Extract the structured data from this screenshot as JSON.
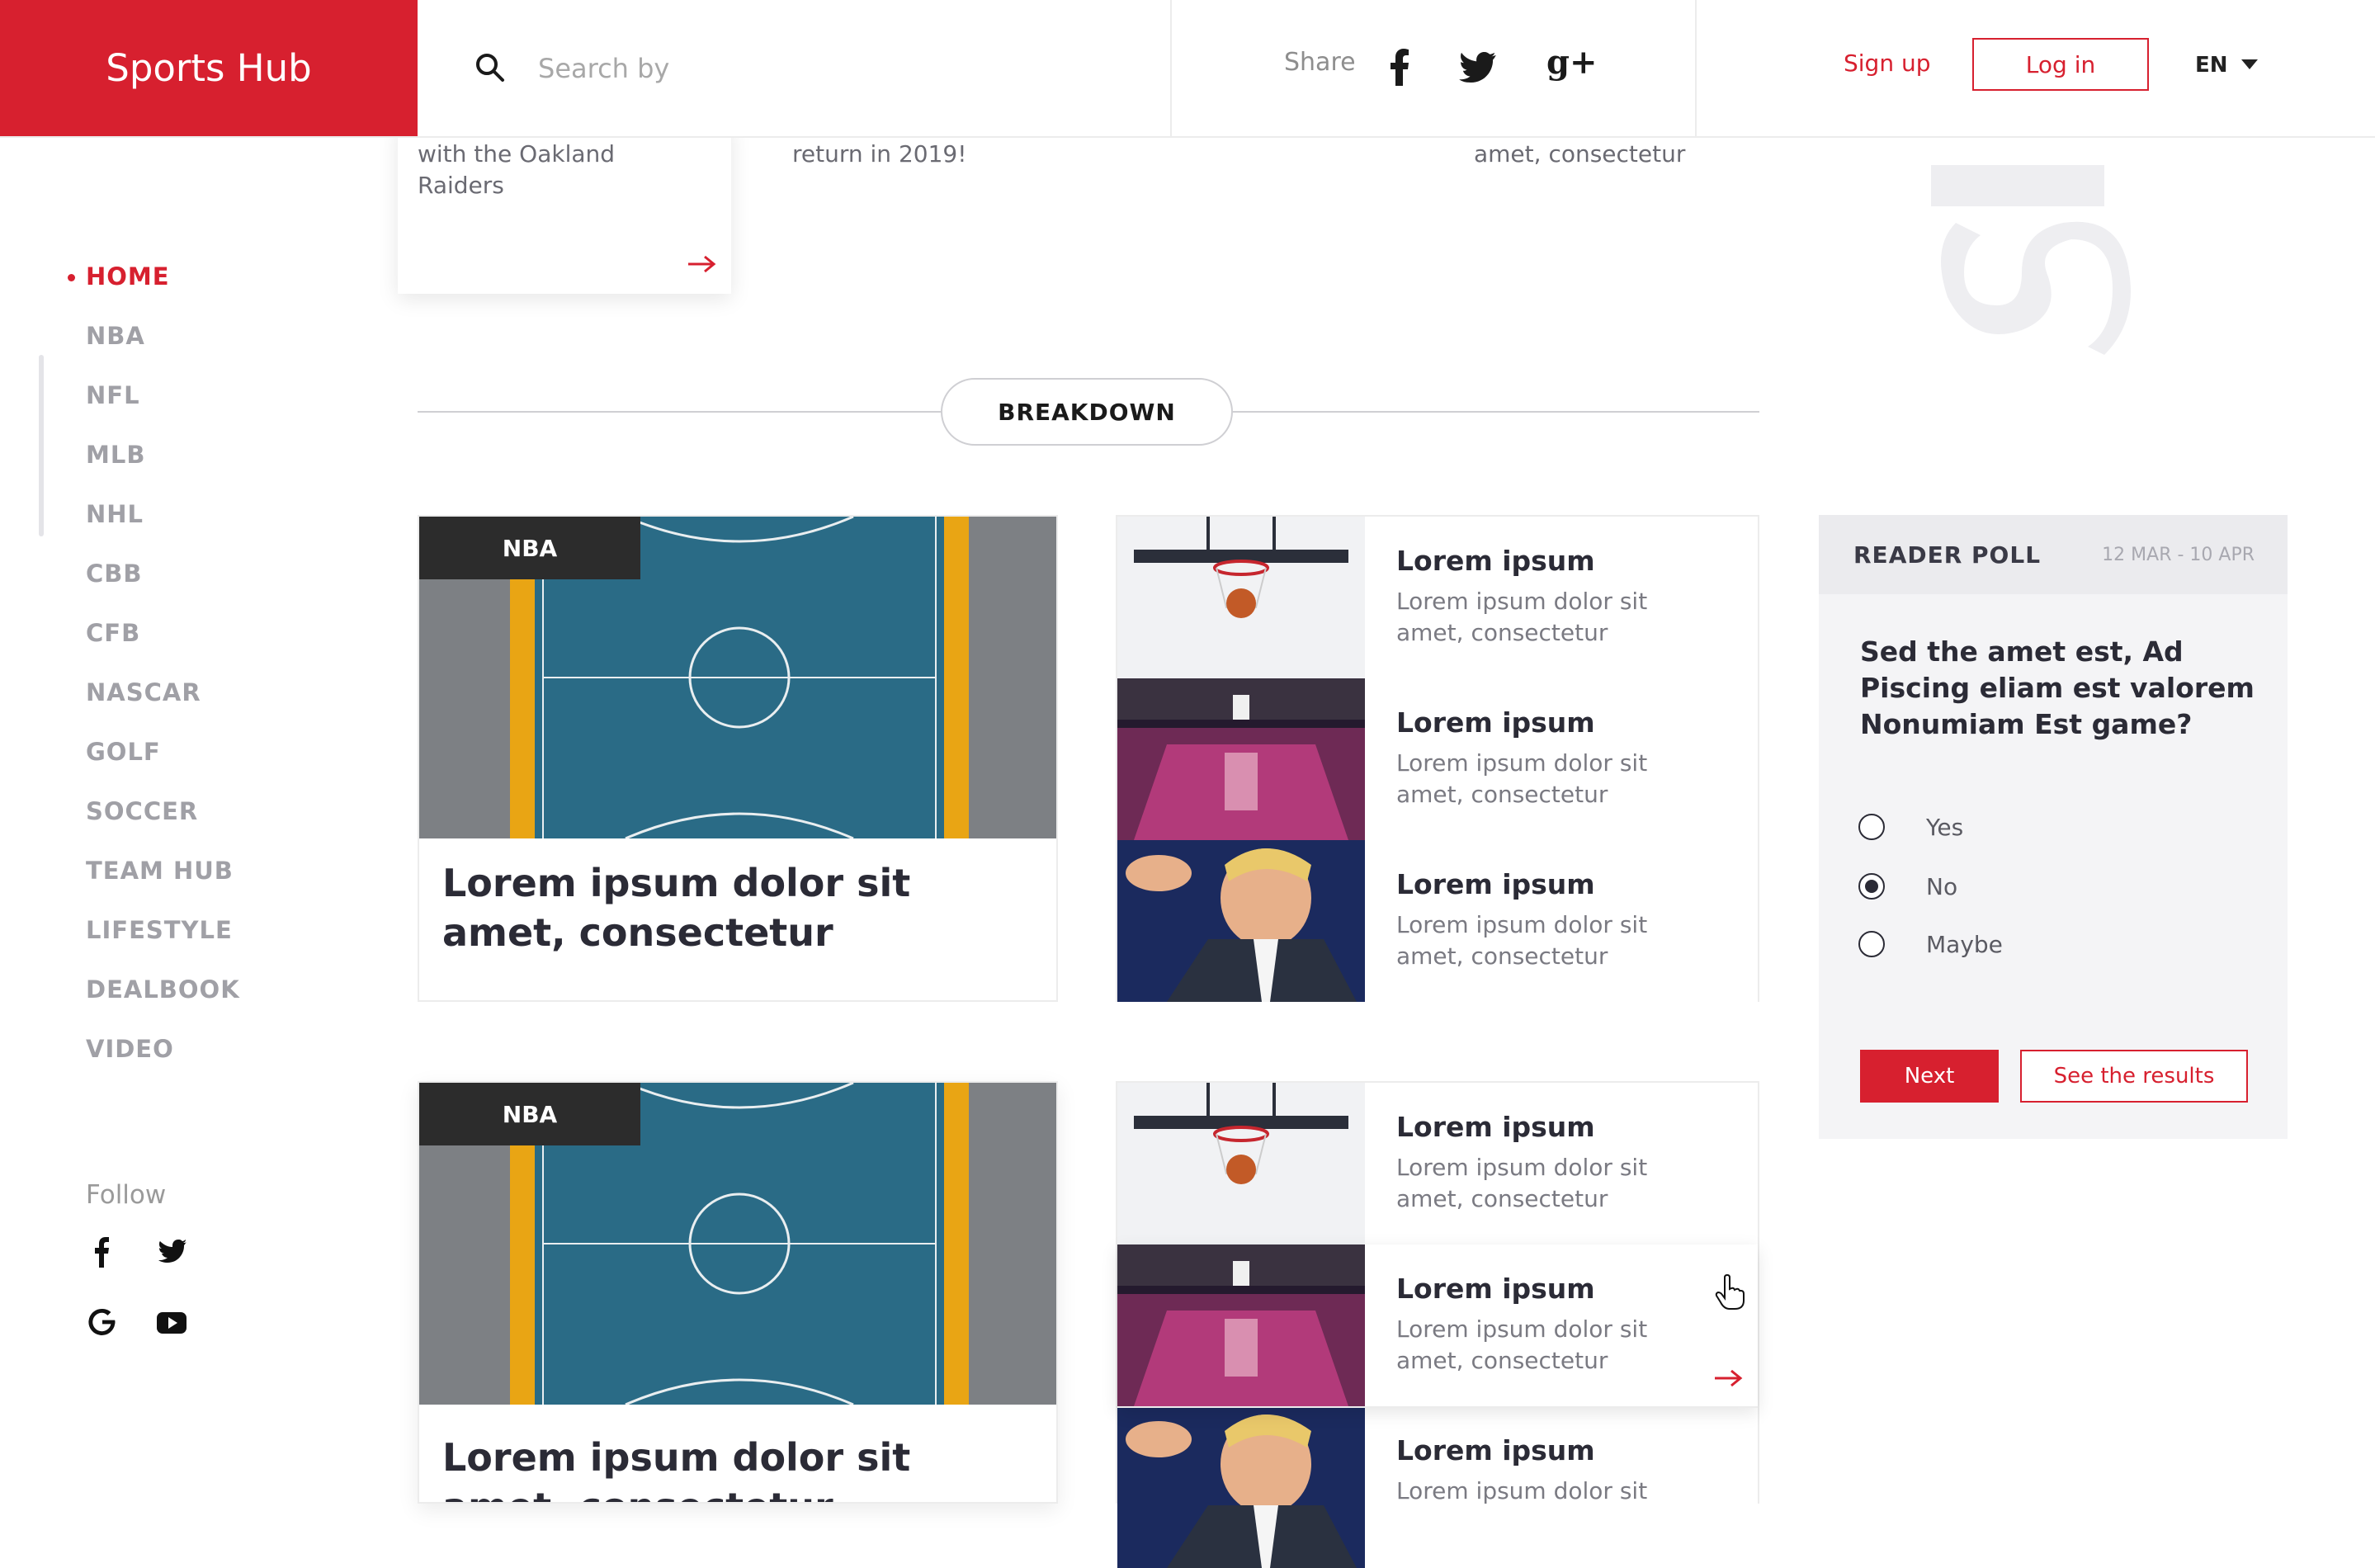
{
  "header": {
    "logo": "Sports Hub",
    "search_placeholder": "Search by",
    "share_label": "Share",
    "signup": "Sign up",
    "login": "Log in",
    "language": "EN"
  },
  "sidebar": {
    "items": [
      {
        "label": "HOME",
        "active": true
      },
      {
        "label": "NBA"
      },
      {
        "label": "NFL"
      },
      {
        "label": "MLB"
      },
      {
        "label": "NHL"
      },
      {
        "label": "CBB"
      },
      {
        "label": "CFB"
      },
      {
        "label": "NASCAR"
      },
      {
        "label": "GOLF"
      },
      {
        "label": "SOCCER"
      },
      {
        "label": "TEAM HUB"
      },
      {
        "label": "LIFESTYLE"
      },
      {
        "label": "DEALBOOK"
      },
      {
        "label": "VIDEO"
      }
    ],
    "follow_label": "Follow",
    "follow_icons": [
      "facebook-icon",
      "twitter-icon",
      "google-icon",
      "youtube-icon"
    ]
  },
  "top_partials": {
    "card1_line1": "with the Oakland",
    "card1_line2": "Raiders",
    "card2_text": "return in 2019!",
    "card3_text": "amet, consectetur"
  },
  "breakdown_label": "BREAKDOWN",
  "big_cards": [
    {
      "tag": "NBA",
      "title_line1": "Lorem ipsum dolor sit",
      "title_line2": "amet, consectetur"
    },
    {
      "tag": "NBA",
      "title_line1": "Lorem ipsum dolor sit",
      "title_line2": "amet, consectetur"
    }
  ],
  "lists": [
    [
      {
        "title": "Lorem ipsum",
        "sub1": "Lorem ipsum dolor sit",
        "sub2": "amet, consectetur",
        "thumb": "basketball-hoop"
      },
      {
        "title": "Lorem ipsum",
        "sub1": "Lorem ipsum dolor sit",
        "sub2": "amet, consectetur",
        "thumb": "arena"
      },
      {
        "title": "Lorem ipsum",
        "sub1": "Lorem ipsum dolor sit",
        "sub2": "amet, consectetur",
        "thumb": "speaker"
      }
    ],
    [
      {
        "title": "Lorem ipsum",
        "sub1": "Lorem ipsum dolor sit",
        "sub2": "amet, consectetur",
        "thumb": "basketball-hoop"
      },
      {
        "title": "Lorem ipsum",
        "sub1": "Lorem ipsum dolor sit",
        "sub2": "amet, consectetur",
        "thumb": "arena"
      },
      {
        "title": "Lorem ipsum",
        "sub1": "Lorem ipsum dolor sit",
        "sub2": "",
        "thumb": "speaker"
      }
    ]
  ],
  "poll": {
    "title": "READER POLL",
    "date": "12 MAR - 10 APR",
    "question": "Sed the amet est, Ad Piscing eliam est valorem Nonumiam Est game?",
    "options": [
      {
        "label": "Yes",
        "selected": false
      },
      {
        "label": "No",
        "selected": true
      },
      {
        "label": "Maybe",
        "selected": false
      }
    ],
    "next": "Next",
    "results": "See the results"
  },
  "colors": {
    "accent": "#d7202f",
    "court": "#2a6b86",
    "tag": "#2c2c2c"
  }
}
